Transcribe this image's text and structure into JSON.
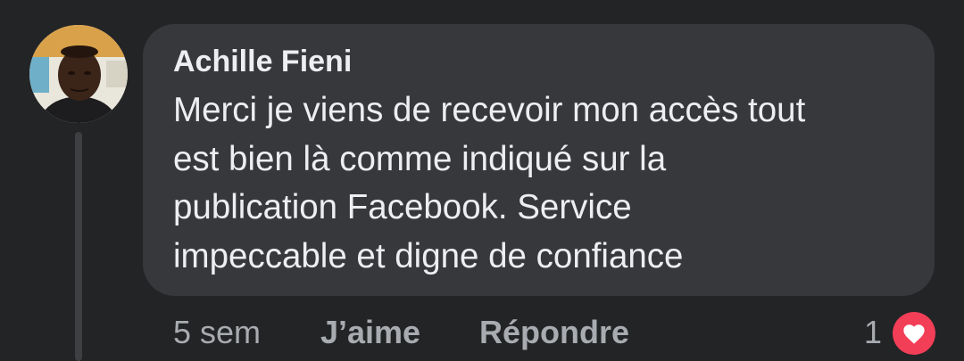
{
  "comment": {
    "author": "Achille Fieni",
    "text": "Merci je viens de recevoir mon accès tout\nest bien là comme indiqué sur la\npublication Facebook. Service\nimpeccable et digne de confiance",
    "time": "5 sem",
    "like_label": "J’aime",
    "reply_label": "Répondre",
    "reaction_count": "1",
    "reaction_icon": "heart-icon"
  },
  "colors": {
    "background": "#232426",
    "bubble": "#37383c",
    "text": "#eceef1",
    "secondary_text": "#a8abb0",
    "heart": "#f33e58"
  }
}
